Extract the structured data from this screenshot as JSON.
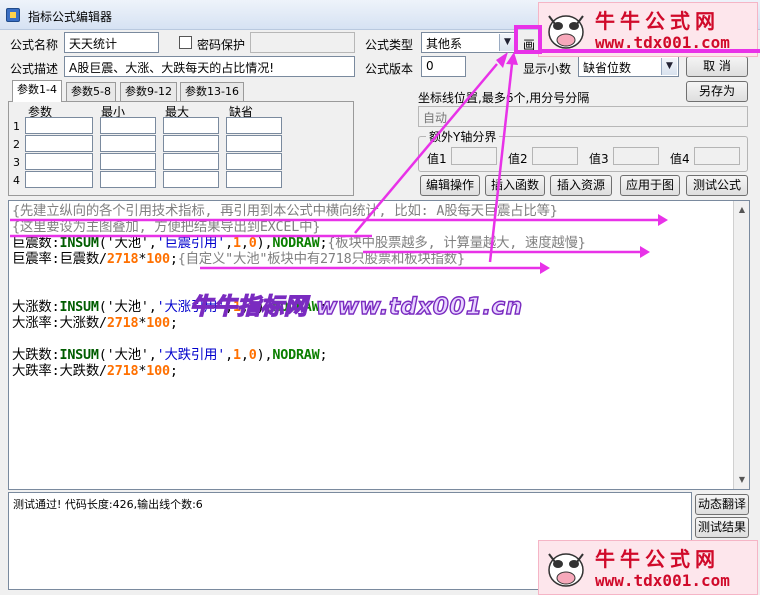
{
  "window": {
    "title": "指标公式编辑器"
  },
  "form": {
    "name_label": "公式名称",
    "name_value": "天天统计",
    "password_label": "密码保护",
    "type_label": "公式类型",
    "type_value": "其他系",
    "draw_label": "画",
    "desc_label": "公式描述",
    "desc_value": "A股巨震、大涨、大跌每天的占比情况!",
    "version_label": "公式版本",
    "version_value": "0",
    "decimals_label": "显示小数",
    "decimals_value": "缺省位数",
    "cancel_button": "取  消",
    "save_as_button": "另存为",
    "axis_label": "坐标线位置,最多6个,用分号分隔",
    "axis_value": "自动",
    "y_group_title": "额外Y轴分界",
    "y_labels": [
      "值1",
      "值2",
      "值3",
      "值4"
    ]
  },
  "params": {
    "tabs": [
      "参数1-4",
      "参数5-8",
      "参数9-12",
      "参数13-16"
    ],
    "columns": [
      "参数",
      "最小",
      "最大",
      "缺省"
    ],
    "rows": [
      "1",
      "2",
      "3",
      "4"
    ]
  },
  "actions": {
    "edit": "编辑操作",
    "insert_fn": "插入函数",
    "insert_res": "插入资源",
    "apply": "应用于图",
    "test": "测试公式"
  },
  "code": {
    "line1": "{先建立纵向的各个引用技术指标, 再引用到本公式中横向统计, 比如: A股每天巨震占比等}",
    "line2": "{这里要设为主图叠加, 方便把结果导出到EXCEL中}",
    "l3_var": "巨震数",
    "l3_fn": "INSUM",
    "l3_s1": "'大池'",
    "l3_s2": "'巨震引用'",
    "l3_n1": "1",
    "l3_n2": "0",
    "l3_kw": "NODRAW",
    "l3_comment": "{板块中股票越多, 计算量越大, 速度越慢}",
    "l4_var": "巨震率",
    "l4_ref": "巨震数",
    "l4_num1": "2718",
    "l4_num2": "100",
    "l4_comment": "{自定义\"大池\"板块中有2718只股票和板块指数}",
    "l6_var": "大涨数",
    "l6_fn": "INSUM",
    "l6_s1": "'大池'",
    "l6_s2": "'大涨引用'",
    "l6_n1": "1",
    "l6_n2": "0",
    "l6_kw": "NODRAW",
    "l7_var": "大涨率",
    "l7_ref": "大涨数",
    "l7_num1": "2718",
    "l7_num2": "100",
    "l9_var": "大跌数",
    "l9_fn": "INSUM",
    "l9_s1": "'大池'",
    "l9_s2": "'大跌引用'",
    "l9_n1": "1",
    "l9_n2": "0",
    "l9_kw": "NODRAW",
    "l10_var": "大跌率",
    "l10_ref": "大跌数",
    "l10_num1": "2718",
    "l10_num2": "100"
  },
  "status": {
    "text": "测试通过! 代码长度:426,输出线个数:6",
    "dyn_translate": "动态翻译",
    "test_result": "测试结果"
  },
  "watermark": {
    "logo_cn": "牛牛公式网",
    "logo_url": "www.tdx001.com",
    "text": "牛牛指标网 www.tdx001.cn"
  },
  "colors": {
    "annotation": "#e832e8",
    "logo_red": "#d00a2a"
  }
}
